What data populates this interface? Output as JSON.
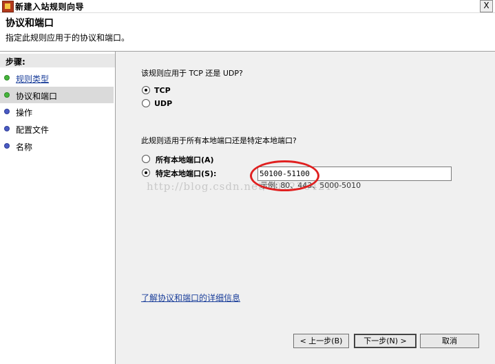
{
  "window": {
    "title": "新建入站规则向导",
    "close_glyph": "X"
  },
  "header": {
    "title": "协议和端口",
    "subtitle": "指定此规则应用于的协议和端口。"
  },
  "sidebar": {
    "heading": "步骤:",
    "items": [
      {
        "label": "规则类型"
      },
      {
        "label": "协议和端口"
      },
      {
        "label": "操作"
      },
      {
        "label": "配置文件"
      },
      {
        "label": "名称"
      }
    ]
  },
  "protocol": {
    "question": "该规则应用于 TCP 还是 UDP?",
    "options": [
      {
        "label": "TCP",
        "selected": true
      },
      {
        "label": "UDP",
        "selected": false
      }
    ]
  },
  "ports": {
    "question": "此规则适用于所有本地端口还是特定本地端口?",
    "options": [
      {
        "label": "所有本地端口(A)",
        "selected": false
      },
      {
        "label": "特定本地端口(S):",
        "selected": true
      }
    ],
    "value": "50100-51100",
    "example": "示例: 80、443、5000-5010"
  },
  "watermark": "http://blog.csdn.net/u012364211",
  "learn_more_link": "了解协议和端口的详细信息",
  "buttons": {
    "back": "< 上一步(B)",
    "next": "下一步(N) >",
    "cancel": "取消"
  },
  "colors": {
    "link": "#1a3e9a",
    "annotation": "#e02020",
    "completed_step": "#46b43c",
    "pending_step": "#4a5bc4"
  }
}
